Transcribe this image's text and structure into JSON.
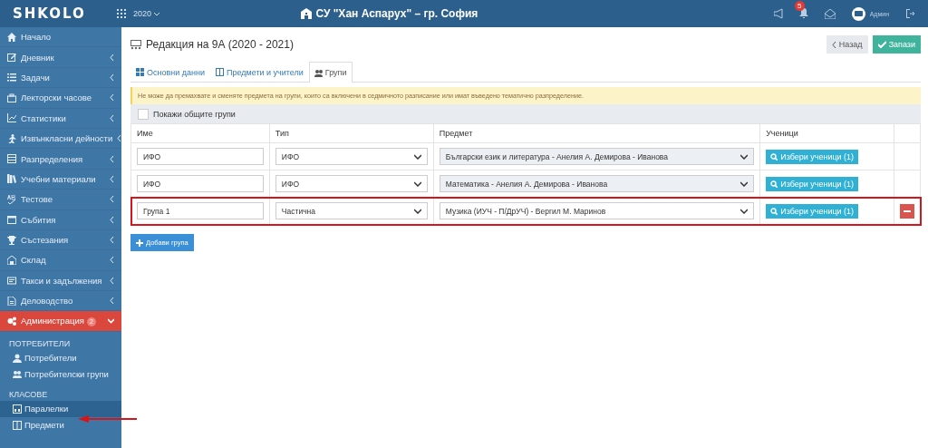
{
  "header": {
    "logo": "SHKOLO",
    "year": "2020",
    "school": "СУ \"Хан Аспарух\" – гр. София",
    "notifications": "5",
    "user": "Админ"
  },
  "sidebar": {
    "items": [
      {
        "label": "Начало",
        "has_arrow": false,
        "selected": false
      },
      {
        "label": "Дневник",
        "has_arrow": true,
        "selected": false
      },
      {
        "label": "Задачи",
        "has_arrow": true,
        "selected": false
      },
      {
        "label": "Лекторски часове",
        "has_arrow": true,
        "selected": false
      },
      {
        "label": "Статистики",
        "has_arrow": true,
        "selected": false
      },
      {
        "label": "Извънкласни дейности",
        "has_arrow": true,
        "selected": false
      },
      {
        "label": "Разпределения",
        "has_arrow": true,
        "selected": false
      },
      {
        "label": "Учебни материали",
        "has_arrow": true,
        "selected": false
      },
      {
        "label": "Тестове",
        "has_arrow": true,
        "selected": false
      },
      {
        "label": "Събития",
        "has_arrow": true,
        "selected": false
      },
      {
        "label": "Състезания",
        "has_arrow": true,
        "selected": false
      },
      {
        "label": "Склад",
        "has_arrow": true,
        "selected": false
      },
      {
        "label": "Такси и задължения",
        "has_arrow": true,
        "selected": false
      },
      {
        "label": "Деловодство",
        "has_arrow": true,
        "selected": false
      },
      {
        "label": "Администрация",
        "badge": "2",
        "has_arrow": true,
        "selected": true
      }
    ],
    "sub": [
      {
        "kind": "heading",
        "label": "ПОТРЕБИТЕЛИ"
      },
      {
        "kind": "link",
        "label": "Потребители",
        "selected": false
      },
      {
        "kind": "link",
        "label": "Потребителски групи",
        "selected": false
      },
      {
        "kind": "heading",
        "label": "КЛАСОВЕ"
      },
      {
        "kind": "link",
        "label": "Паралелки",
        "selected": true
      },
      {
        "kind": "link",
        "label": "Предмети",
        "selected": false
      }
    ]
  },
  "page": {
    "title": "Редакция на 9А (2020 - 2021)",
    "back": "Назад",
    "save": "Запази",
    "tabs": [
      {
        "label": "Основни данни",
        "selected": false
      },
      {
        "label": "Предмети и учители",
        "selected": false
      },
      {
        "label": "Групи",
        "selected": true
      }
    ],
    "alert": "Не може да премахвате и сменяте предмета на групи, които са включени в седмичното разписание или имат въведено тематично разпределение.",
    "show_common": {
      "label": "Покажи общите групи",
      "checked": false
    },
    "table": {
      "columns": [
        "Име",
        "Тип",
        "Предмет",
        "Ученици"
      ],
      "rows": [
        {
          "name": "ИФО",
          "type": "ИФО",
          "subject": "Български език и литература - Анелия А. Демирова - Иванова",
          "subject_disabled": true,
          "students": "Избери ученици (1)",
          "highlighted": false,
          "removable": false
        },
        {
          "name": "ИФО",
          "type": "ИФО",
          "subject": "Математика - Анелия А. Демирова - Иванова",
          "subject_disabled": true,
          "students": "Избери ученици (1)",
          "highlighted": false,
          "removable": false
        },
        {
          "name": "Група 1",
          "type": "Частична",
          "subject": "Музика (ИУЧ - П/ДрУЧ) - Вергил М. Маринов",
          "subject_disabled": false,
          "students": "Избери ученици (1)",
          "highlighted": true,
          "removable": true
        }
      ]
    },
    "add": "Добави група"
  }
}
